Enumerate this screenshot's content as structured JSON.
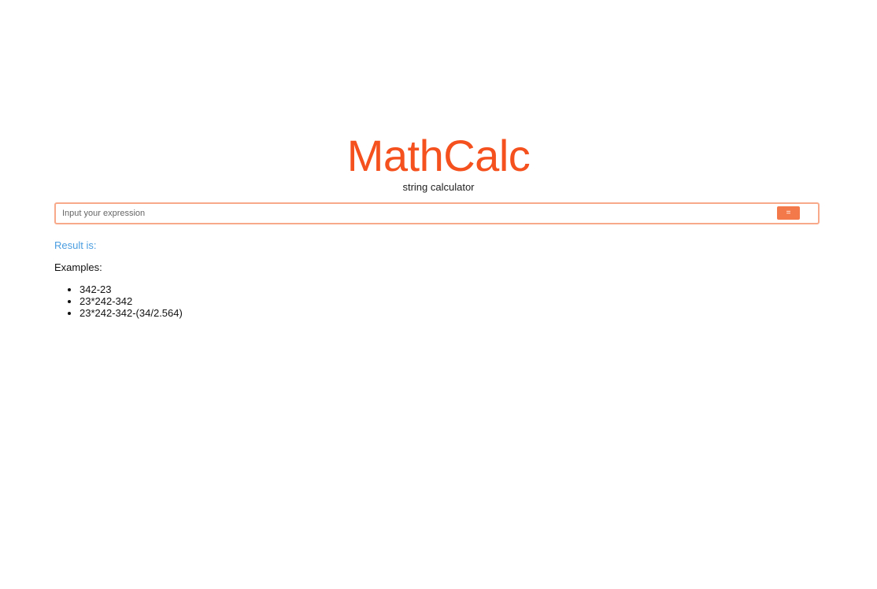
{
  "header": {
    "title": "MathCalc",
    "subtitle": "string calculator"
  },
  "calculator": {
    "input_value": "",
    "input_placeholder": "Input your expression",
    "equals_label": "="
  },
  "result": {
    "label": "Result is:"
  },
  "examples": {
    "label": "Examples:",
    "items": [
      "342-23",
      "23*242-342",
      "23*242-342-(34/2.564)"
    ]
  },
  "colors": {
    "title": "#f4511e",
    "button": "#f4794a",
    "input_border": "#f7a98a",
    "result_text": "#4a9de0"
  }
}
